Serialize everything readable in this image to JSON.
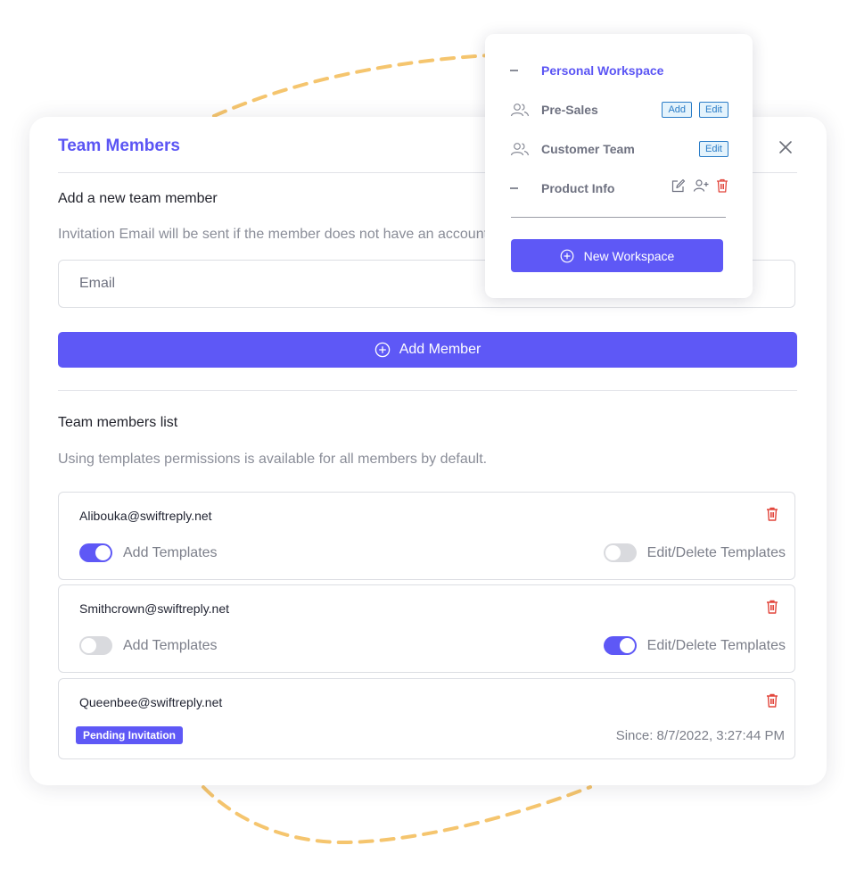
{
  "modal": {
    "title": "Team Members",
    "add_section_title": "Add a new team member",
    "add_section_hint": "Invitation Email will be sent if the member does not have an account yet.",
    "email_placeholder": "Email",
    "email_value": "",
    "add_button_label": "Add Member",
    "list_title": "Team members list",
    "list_hint": "Using templates permissions is available for all members by default."
  },
  "members": [
    {
      "email": "Alibouka@swiftreply.net",
      "add_templates_label": "Add Templates",
      "add_templates_enabled": true,
      "edit_templates_label": "Edit/Delete Templates",
      "edit_templates_enabled": false
    },
    {
      "email": "Smithcrown@swiftreply.net",
      "add_templates_label": "Add Templates",
      "add_templates_enabled": false,
      "edit_templates_label": "Edit/Delete Templates",
      "edit_templates_enabled": true
    },
    {
      "email": "Queenbee@swiftreply.net",
      "status_badge": "Pending Invitation",
      "since": "Since: 8/7/2022, 3:27:44 PM"
    }
  ],
  "workspaces": {
    "items": [
      {
        "label": "Personal Workspace",
        "icon": "dash-icon",
        "active": true
      },
      {
        "label": "Pre-Sales",
        "icon": "users-icon",
        "actions": [
          "Add",
          "Edit"
        ]
      },
      {
        "label": "Customer Team",
        "icon": "users-icon",
        "actions": [
          "Edit"
        ]
      },
      {
        "label": "Product Info",
        "icon": "dash-icon",
        "icon_actions": [
          "edit-icon",
          "add-user-icon",
          "trash-icon"
        ]
      }
    ],
    "new_workspace_label": "New Workspace"
  },
  "colors": {
    "accent": "#5e58f6",
    "title": "#5b55f4",
    "danger": "#e2463c",
    "chip_blue": "#2a7cc7",
    "chip_bg": "#e4f3fc",
    "decoration": "#f5c56e"
  }
}
